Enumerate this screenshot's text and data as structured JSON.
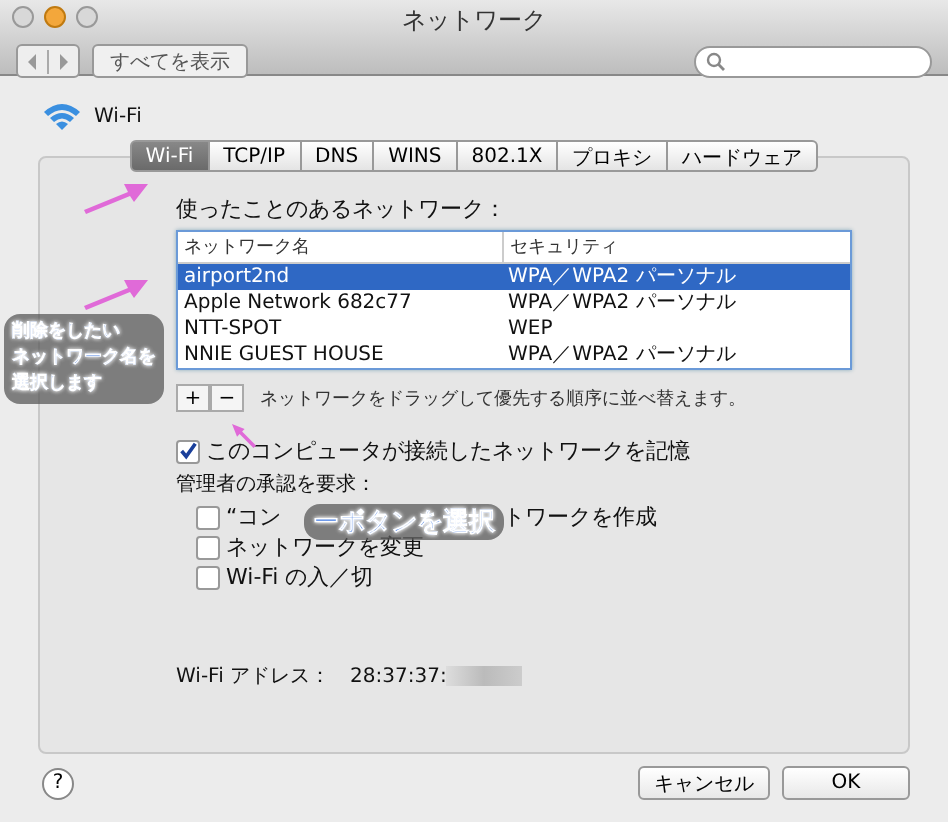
{
  "window": {
    "title": "ネットワーク"
  },
  "toolbar": {
    "show_all_button": "すべてを表示"
  },
  "service": {
    "name": "Wi-Fi"
  },
  "tabs": [
    {
      "label": "Wi-Fi",
      "selected": true
    },
    {
      "label": "TCP/IP",
      "selected": false
    },
    {
      "label": "DNS",
      "selected": false
    },
    {
      "label": "WINS",
      "selected": false
    },
    {
      "label": "802.1X",
      "selected": false
    },
    {
      "label": "プロキシ",
      "selected": false
    },
    {
      "label": "ハードウェア",
      "selected": false
    }
  ],
  "networks_label": "使ったことのあるネットワーク：",
  "table": {
    "columns": [
      "ネットワーク名",
      "セキュリティ"
    ],
    "rows": [
      {
        "name": "airport2nd",
        "security": "WPA／WPA2 パーソナル",
        "selected": true
      },
      {
        "name": "Apple Network 682c77",
        "security": "WPA／WPA2 パーソナル",
        "selected": false
      },
      {
        "name": "NTT-SPOT",
        "security": "WEP",
        "selected": false
      },
      {
        "name": "NNIE GUEST HOUSE",
        "security": "WPA／WPA2 パーソナル",
        "selected": false
      }
    ]
  },
  "list_buttons": [
    "+",
    "−"
  ],
  "hint": "ネットワークをドラッグして優先する順序に並べ替えます。",
  "remember": {
    "label": "このコンピュータが接続したネットワークを記憶",
    "checked": true
  },
  "admin_label": "管理者の承認を要求：",
  "admin_options": [
    {
      "parts": [
        "“コン",
        "トワークを作成"
      ],
      "checked": false
    },
    {
      "parts": [
        "ネットワークを変更"
      ],
      "checked": false
    },
    {
      "parts": [
        "Wi-Fi の入／切"
      ],
      "checked": false
    }
  ],
  "address": {
    "label": "Wi-Fi アドレス：",
    "value": "28:37:37:"
  },
  "help_button": "?",
  "buttons": [
    "キャンセル",
    "OK"
  ],
  "annotations": [
    [
      "削除をしたい",
      "ネットワーク名を",
      "選択します"
    ],
    "ーボタンを選択"
  ]
}
